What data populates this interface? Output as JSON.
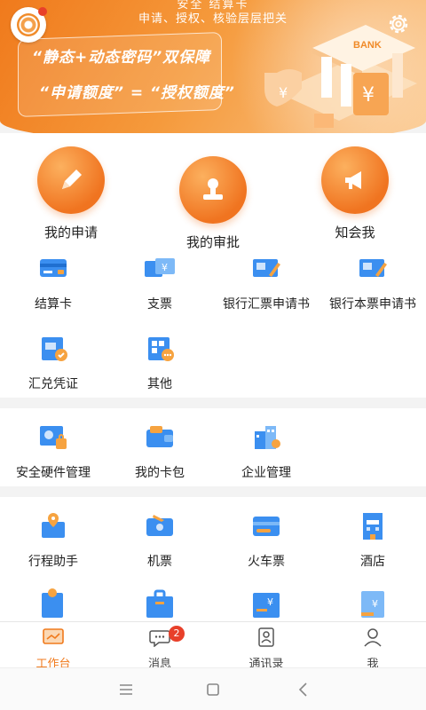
{
  "header": {
    "top_line1": "安全 结算卡",
    "top_line2": "申请、授权、核验层层把关",
    "slogan1": "“静态+动态密码”双保障",
    "slogan2": "“申请额度” = “授权额度”",
    "bank_sign": "BANK",
    "colors": {
      "primary": "#f07a1c",
      "light": "#fbc98f"
    }
  },
  "main_actions": [
    {
      "label": "我的申请",
      "icon": "pencil-icon"
    },
    {
      "label": "我的审批",
      "icon": "stamp-icon"
    },
    {
      "label": "知会我",
      "icon": "megaphone-icon"
    }
  ],
  "grid1": [
    {
      "label": "结算卡",
      "icon": "card-icon"
    },
    {
      "label": "支票",
      "icon": "cheque-icon"
    },
    {
      "label": "银行汇票申请书",
      "icon": "bank-draft-icon"
    },
    {
      "label": "银行本票申请书",
      "icon": "cashier-cheque-icon"
    },
    {
      "label": "汇兑凭证",
      "icon": "remittance-icon"
    },
    {
      "label": "其他",
      "icon": "more-icon"
    }
  ],
  "grid2": [
    {
      "label": "安全硬件管理",
      "icon": "security-hardware-icon"
    },
    {
      "label": "我的卡包",
      "icon": "wallet-icon"
    },
    {
      "label": "企业管理",
      "icon": "enterprise-icon"
    }
  ],
  "grid3": [
    {
      "label": "行程助手",
      "icon": "itinerary-icon"
    },
    {
      "label": "机票",
      "icon": "flight-icon"
    },
    {
      "label": "火车票",
      "icon": "train-icon"
    },
    {
      "label": "酒店",
      "icon": "hotel-icon"
    }
  ],
  "tabs": [
    {
      "label": "工作台",
      "icon": "workbench-icon",
      "active": true
    },
    {
      "label": "消息",
      "icon": "message-icon",
      "badge": "2"
    },
    {
      "label": "通讯录",
      "icon": "contacts-icon"
    },
    {
      "label": "我",
      "icon": "profile-icon"
    }
  ]
}
